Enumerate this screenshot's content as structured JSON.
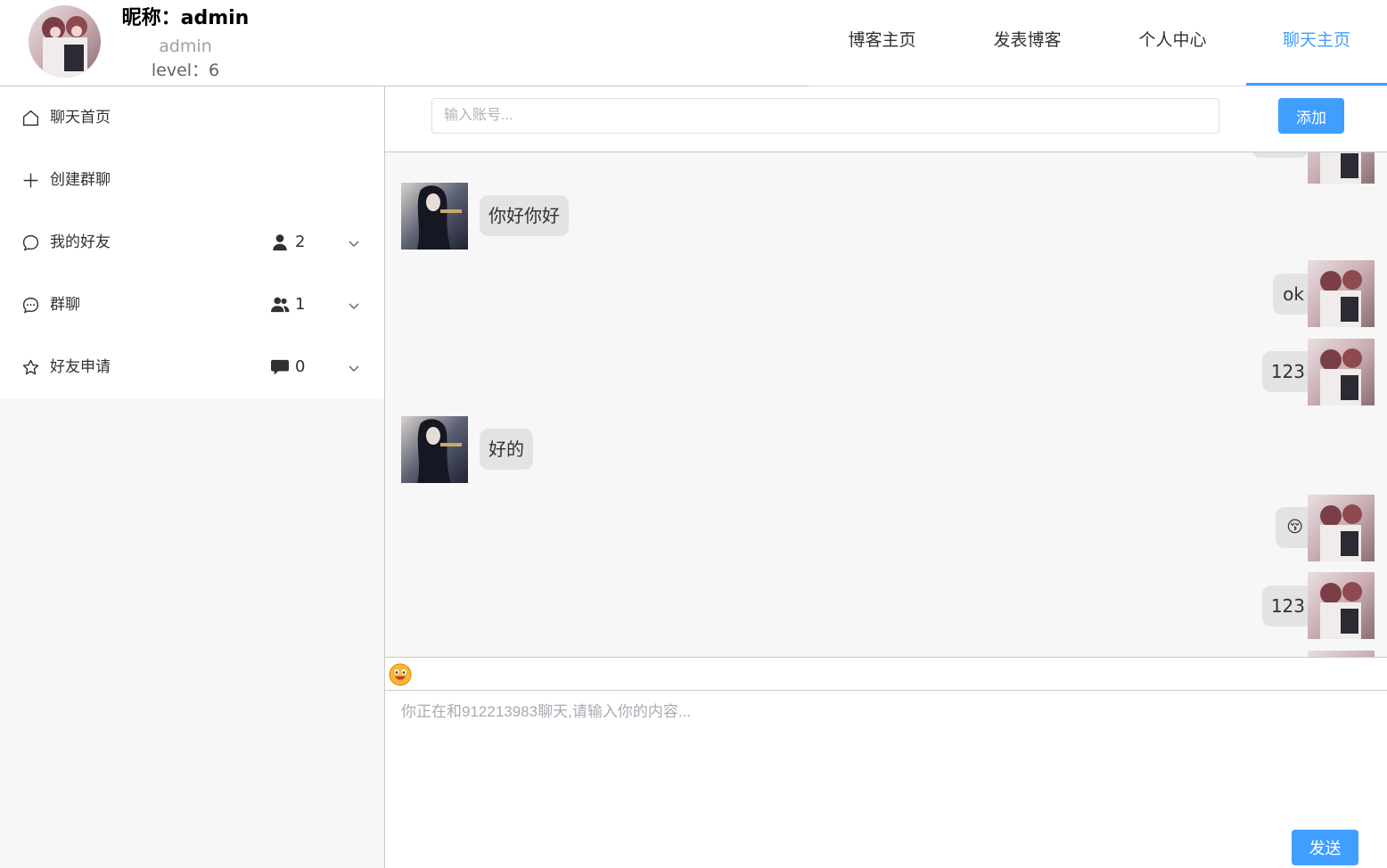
{
  "user": {
    "nickname": "昵称：admin",
    "username": "admin",
    "level": "level：6"
  },
  "nav": {
    "items": [
      {
        "label": "博客主页",
        "active": false
      },
      {
        "label": "发表博客",
        "active": false
      },
      {
        "label": "个人中心",
        "active": false
      },
      {
        "label": "聊天主页",
        "active": true
      }
    ]
  },
  "sidebar": {
    "items": [
      {
        "label": "聊天首页",
        "icon": "home-icon"
      },
      {
        "label": "创建群聊",
        "icon": "plus-icon"
      },
      {
        "label": "我的好友",
        "icon": "chat-bubble-icon",
        "count_icon": "user-icon",
        "count": "2"
      },
      {
        "label": "群聊",
        "icon": "chat-dots-icon",
        "count_icon": "users-icon",
        "count": "1"
      },
      {
        "label": "好友申请",
        "icon": "star-icon",
        "count_icon": "comment-icon",
        "count": "0"
      }
    ]
  },
  "add_friend": {
    "placeholder": "输入账号...",
    "button": "添加"
  },
  "messages": [
    {
      "side": "left",
      "text": "你好你好"
    },
    {
      "side": "right",
      "text": "ok"
    },
    {
      "side": "right",
      "text": "123"
    },
    {
      "side": "left",
      "text": "好的"
    },
    {
      "side": "right",
      "text": "😚"
    },
    {
      "side": "right",
      "text": "123"
    }
  ],
  "composer": {
    "placeholder": "你正在和912213983聊天,请输入你的内容...",
    "send_button": "发送"
  },
  "colors": {
    "accent": "#409eff",
    "bubble": "#e3e3e3",
    "panel_bg": "#f7f7f7"
  }
}
